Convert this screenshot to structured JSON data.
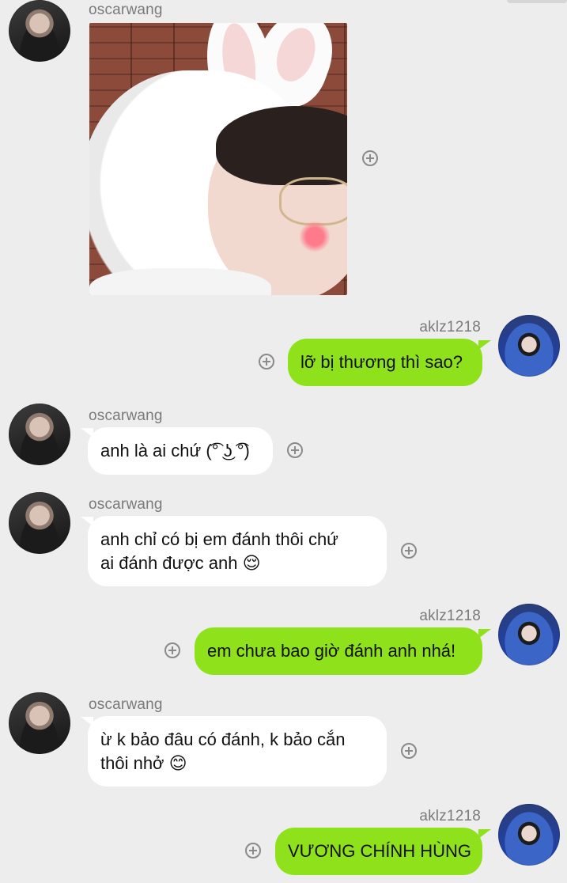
{
  "messages": [
    {
      "sender": "oscarwang",
      "side": "left",
      "type": "image",
      "avatar": "avatar-oscarwang"
    },
    {
      "sender": "aklz1218",
      "side": "right",
      "type": "text",
      "text": "lỡ bị thương thì sao?",
      "avatar": "avatar-aklz1218"
    },
    {
      "sender": "oscarwang",
      "side": "left",
      "type": "text",
      "text": "anh là ai chứ (͡° ͜ʖ ͡°)",
      "avatar": "avatar-oscarwang"
    },
    {
      "sender": "oscarwang",
      "side": "left",
      "type": "text",
      "lines": [
        "anh chỉ có bị em đánh thôi chứ",
        "ai đánh được anh 😌"
      ],
      "avatar": "avatar-oscarwang"
    },
    {
      "sender": "aklz1218",
      "side": "right",
      "type": "text",
      "text": "em chưa bao giờ đánh anh nhá!",
      "avatar": "avatar-aklz1218"
    },
    {
      "sender": "oscarwang",
      "side": "left",
      "type": "text",
      "lines": [
        "ừ k bảo đâu có đánh, k bảo cắn",
        "thôi nhở 😊"
      ],
      "avatar": "avatar-oscarwang"
    },
    {
      "sender": "aklz1218",
      "side": "right",
      "type": "text",
      "text": "VƯƠNG CHÍNH HÙNG",
      "avatar": "avatar-aklz1218"
    }
  ],
  "colors": {
    "background": "#ededed",
    "bubble_mine": "#8fe21b",
    "bubble_theirs": "#ffffff",
    "name_text": "#7a7a7a"
  },
  "icons": {
    "action": "plus-circle-icon"
  }
}
